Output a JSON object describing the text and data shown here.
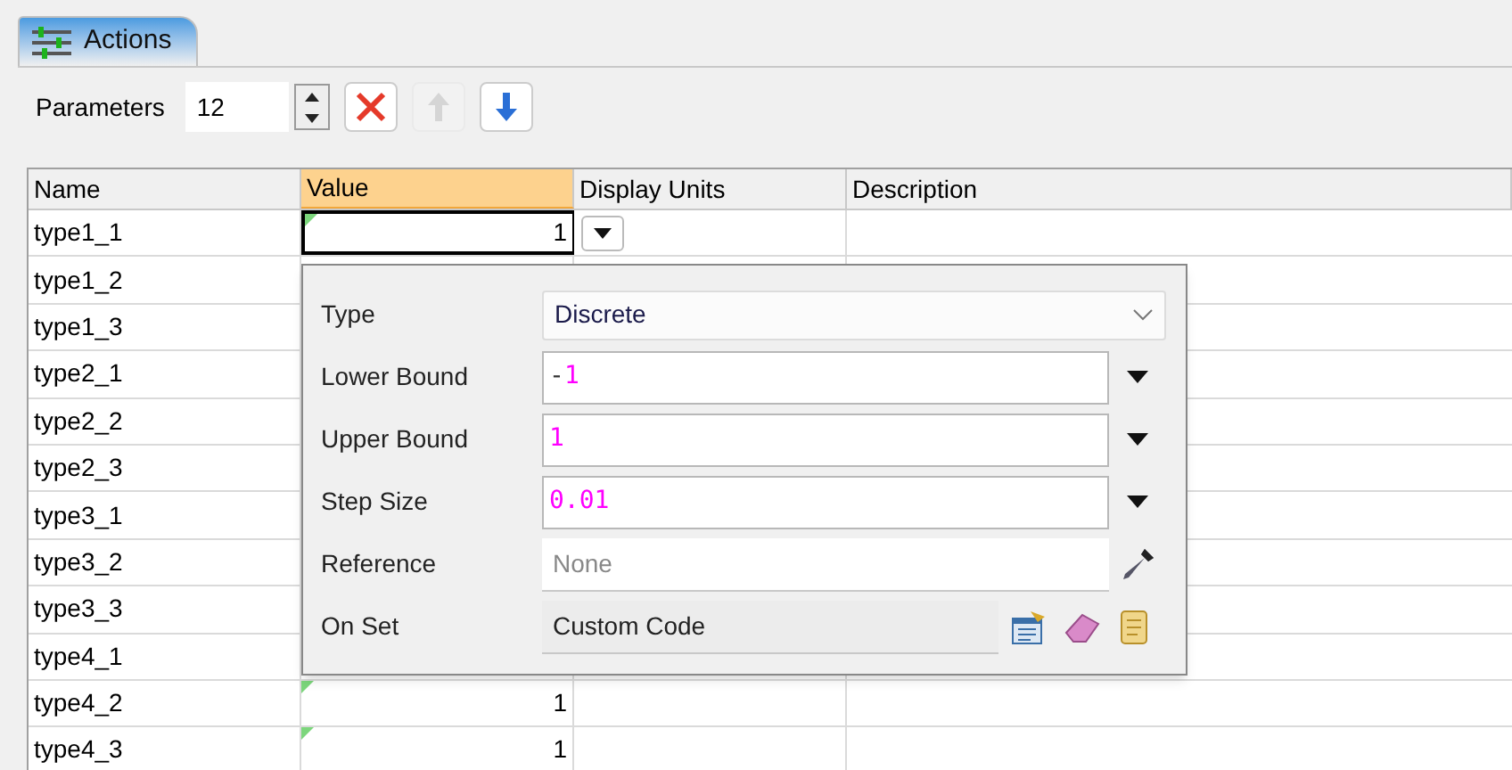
{
  "tab": {
    "label": "Actions",
    "selected": true
  },
  "toolbar": {
    "label": "Parameters",
    "count": "12",
    "move_up_disabled": true
  },
  "table": {
    "columns": [
      {
        "label": "Name",
        "sorted": false
      },
      {
        "label": "Value",
        "sorted": true
      },
      {
        "label": "Display Units",
        "sorted": false
      },
      {
        "label": "Description",
        "sorted": false
      }
    ],
    "rows": [
      {
        "name": "type1_1",
        "value_cell": {
          "value": "1",
          "editing": true
        }
      },
      {
        "name": "type1_2"
      },
      {
        "name": "type1_3"
      },
      {
        "name": "type2_1"
      },
      {
        "name": "type2_2"
      },
      {
        "name": "type2_3"
      },
      {
        "name": "type3_1"
      },
      {
        "name": "type3_2"
      },
      {
        "name": "type3_3"
      },
      {
        "name": "type4_1"
      },
      {
        "name": "type4_2",
        "value_cell": {
          "value": "1",
          "editing": false
        }
      },
      {
        "name": "type4_3",
        "value_cell": {
          "value": "1",
          "editing": false
        }
      }
    ]
  },
  "popup": {
    "fields": [
      {
        "kind": "select",
        "label": "Type",
        "value": "Discrete"
      },
      {
        "kind": "number",
        "label": "Lower Bound",
        "value": "-1"
      },
      {
        "kind": "number",
        "label": "Upper Bound",
        "value": "1"
      },
      {
        "kind": "number",
        "label": "Step Size",
        "value": "0.01"
      },
      {
        "kind": "reference",
        "label": "Reference",
        "placeholder": "None"
      },
      {
        "kind": "code",
        "label": "On Set",
        "value": "Custom Code"
      }
    ]
  }
}
